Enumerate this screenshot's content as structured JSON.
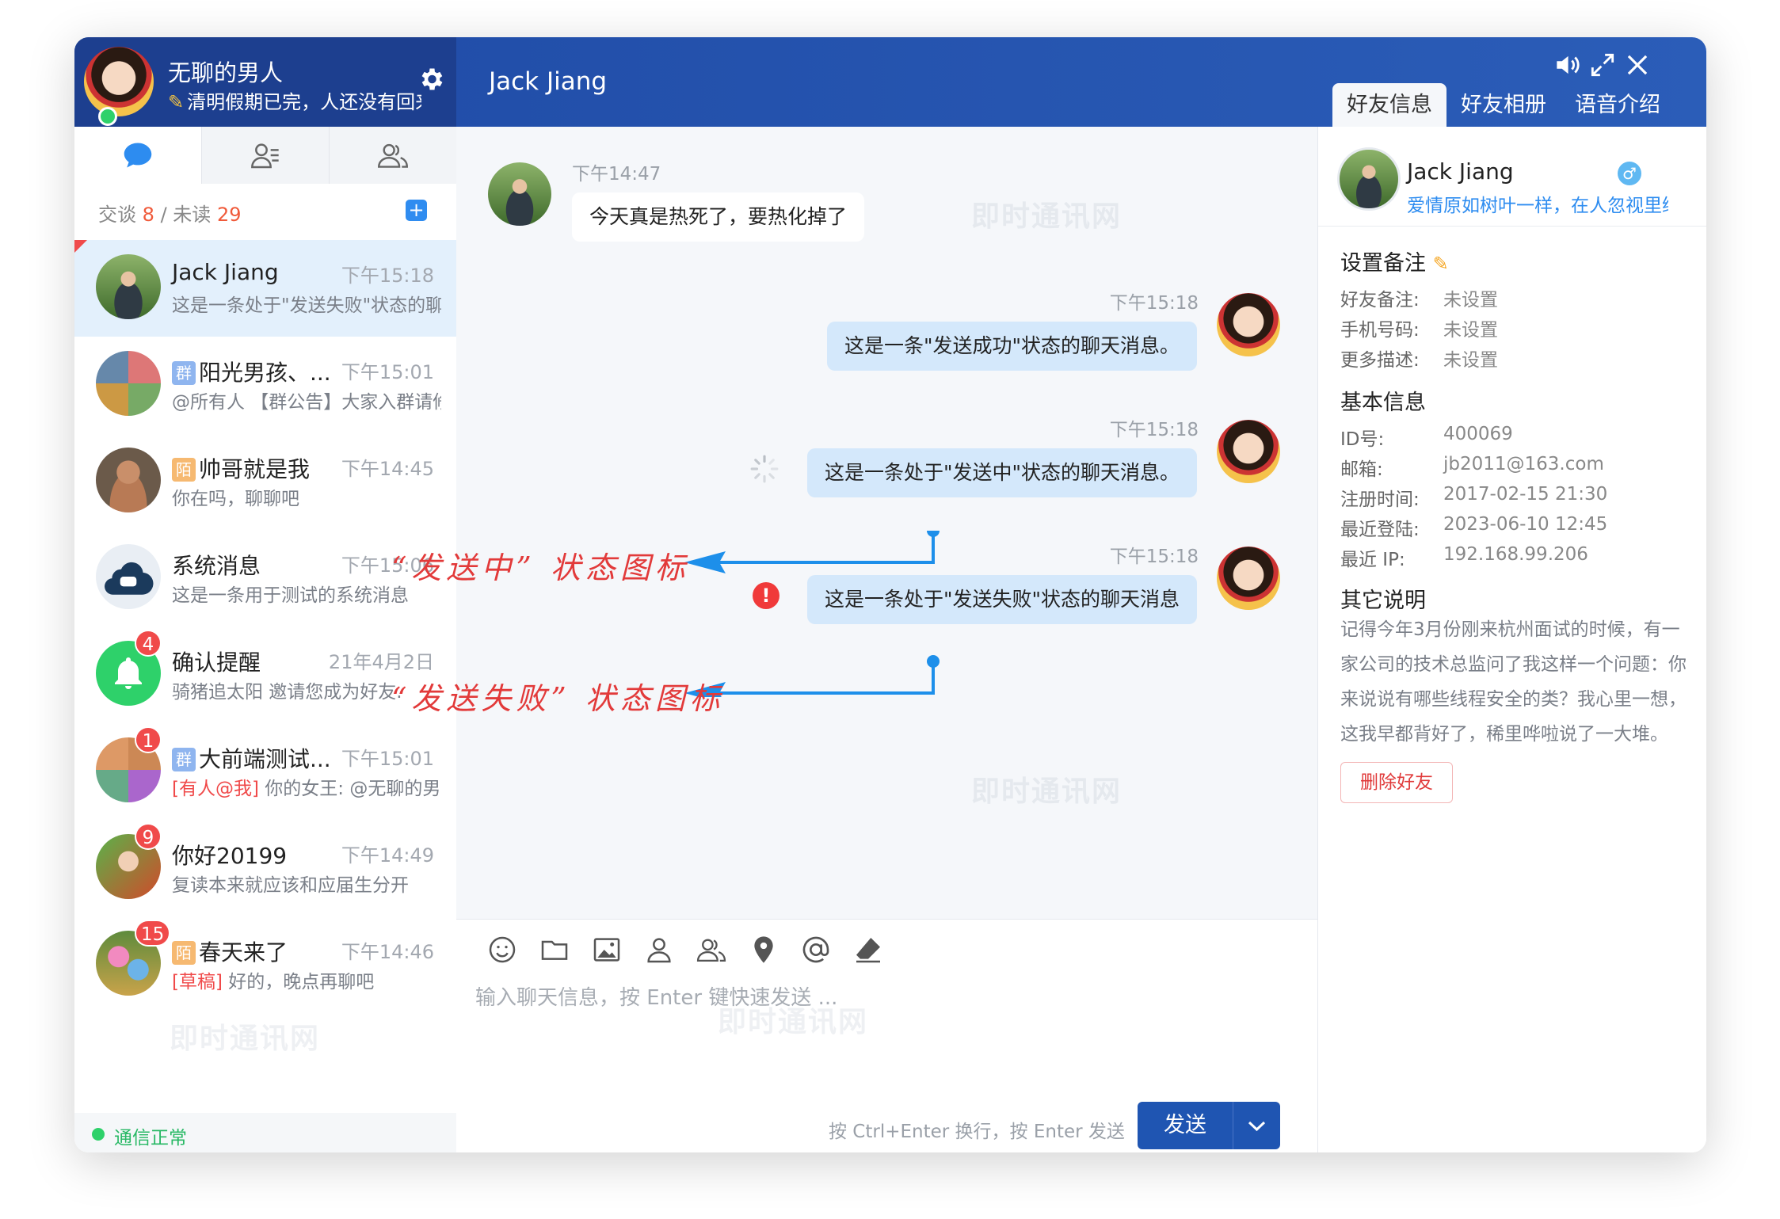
{
  "me": {
    "name": "无聊的男人",
    "signature": "清明假期已完，人还没有回来"
  },
  "chat": {
    "title": "Jack Jiang"
  },
  "right_tabs": [
    "好友信息",
    "好友相册",
    "语音介绍"
  ],
  "stats": {
    "talk_label": "交谈",
    "talk_count": "8",
    "sep": "/",
    "unread_label": "未读",
    "unread_count": "29"
  },
  "conversations": [
    {
      "name": "Jack Jiang",
      "time": "下午15:18",
      "preview": "这是一条处于\"发送失败\"状态的聊天消息"
    },
    {
      "tag": "群",
      "name": "阳光男孩、...",
      "time": "下午15:01",
      "preview": "@所有人 【群公告】大家入群请修改群名片"
    },
    {
      "tag": "陌",
      "name": "帅哥就是我",
      "time": "下午14:45",
      "preview": "你在吗，聊聊吧"
    },
    {
      "name": "系统消息",
      "time": "下午15:06",
      "preview": "这是一条用于测试的系统消息"
    },
    {
      "name": "确认提醒",
      "time": "21年4月2日",
      "preview": "骑猪追太阳 邀请您成为好友.",
      "badge": "4"
    },
    {
      "tag": "群",
      "name": "大前端测试...",
      "time": "下午15:01",
      "prefix": "[有人@我]",
      "preview": "你的女王: @无聊的男人",
      "badge": "1"
    },
    {
      "name": "你好20199",
      "time": "下午14:49",
      "preview": "复读本来就应该和应届生分开",
      "badge": "9"
    },
    {
      "tag": "陌",
      "name": "春天来了",
      "time": "下午14:46",
      "prefix": "[草稿]",
      "preview": "好的，晚点再聊吧",
      "badge": "15"
    }
  ],
  "status_text": "通信正常",
  "watermark": "即时通讯网",
  "messages": [
    {
      "time": "下午14:47",
      "text": "今天真是热死了，要热化掉了",
      "dir": "in"
    },
    {
      "time": "下午15:18",
      "text": "这是一条\"发送成功\"状态的聊天消息。",
      "dir": "out"
    },
    {
      "time": "下午15:18",
      "text": "这是一条处于\"发送中\"状态的聊天消息。",
      "dir": "out",
      "state": "sending"
    },
    {
      "time": "下午15:18",
      "text": "这是一条处于\"发送失败\"状态的聊天消息",
      "dir": "out",
      "state": "failed"
    }
  ],
  "annotations": {
    "sending": "“发送中” 状态图标",
    "failed": "“发送失败” 状态图标"
  },
  "error_mark": "!",
  "input": {
    "placeholder": "输入聊天信息，按 Enter 键快速发送 ..."
  },
  "send_hint": "按 Ctrl+Enter 换行，按 Enter 发送",
  "send_label": "发送",
  "profile": {
    "name": "Jack Jiang",
    "gender": "♂",
    "signature": "爱情原如树叶一样，在人忽视里绿了"
  },
  "remark": {
    "title": "设置备注",
    "rows": [
      {
        "label": "好友备注:",
        "value": "未设置"
      },
      {
        "label": "手机号码:",
        "value": "未设置"
      },
      {
        "label": "更多描述:",
        "value": "未设置"
      }
    ]
  },
  "basic": {
    "title": "基本信息",
    "rows": [
      {
        "label": "ID号:",
        "value": "400069"
      },
      {
        "label": "邮箱:",
        "value": "jb2011@163.com"
      },
      {
        "label": "注册时间:",
        "value": "2017-02-15 21:30"
      },
      {
        "label": "最近登陆:",
        "value": "2023-06-10 12:45"
      },
      {
        "label": "最近 IP:",
        "value": "192.168.99.206"
      }
    ]
  },
  "other": {
    "title": "其它说明",
    "text": "记得今年3月份刚来杭州面试的时候，有一家公司的技术总监问了我这样一个问题：你来说说有哪些线程安全的类？我心里一想，这我早都背好了，稀里哗啦说了一大堆。"
  },
  "delete_label": "删除好友",
  "colors": {
    "header": "#1f4aa5",
    "accent": "#2d8cf0",
    "danger": "#f04a4a",
    "online": "#2ed16a"
  }
}
